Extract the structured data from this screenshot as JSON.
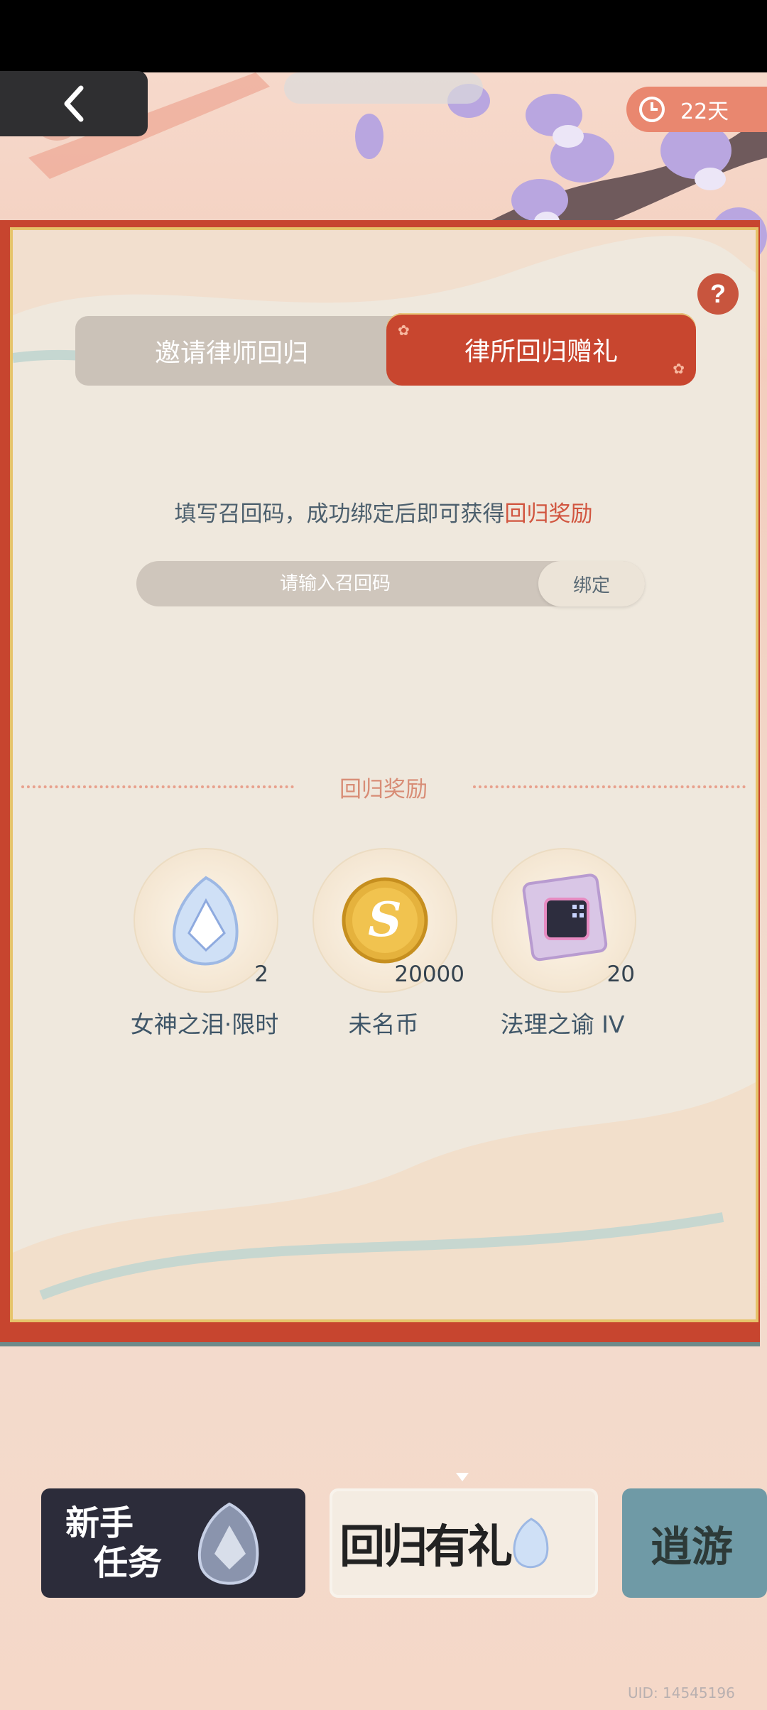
{
  "timer": {
    "label": "22天"
  },
  "tabs": {
    "left": "邀请律师回归",
    "right": "律所回归赠礼"
  },
  "hint": {
    "prefix": "填写召回码，成功绑定后即可获得",
    "highlight": "回归奖励"
  },
  "code_input": {
    "placeholder": "请输入召回码",
    "bind_label": "绑定"
  },
  "section_title": "回归奖励",
  "rewards": [
    {
      "name": "女神之泪·限时",
      "count": "2",
      "icon": "tear-crystal-icon"
    },
    {
      "name": "未名币",
      "count": "20000",
      "icon": "gold-coin-icon"
    },
    {
      "name": "法理之谕 IV",
      "count": "20",
      "icon": "card-chip-icon"
    }
  ],
  "bottom_tabs": [
    {
      "label": "新手\n任务",
      "l1": "新手",
      "l2": "任务"
    },
    {
      "label": "回归有礼"
    },
    {
      "label": "逍游"
    }
  ],
  "uid": "UID: 14545196",
  "colors": {
    "accent": "#c8462f",
    "highlight": "#d1553f",
    "text": "#4c5f6d"
  }
}
